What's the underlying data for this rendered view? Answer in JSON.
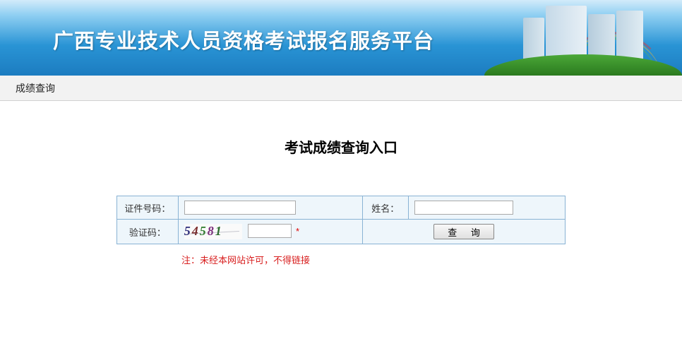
{
  "banner": {
    "title": "广西专业技术人员资格考试报名服务平台"
  },
  "nav": {
    "score_query": "成绩查询"
  },
  "page": {
    "title": "考试成绩查询入口"
  },
  "form": {
    "id_label": "证件号码：",
    "name_label": "姓名：",
    "captcha_label": "验证码：",
    "captcha_value": "54581",
    "required_mark": "*",
    "submit_label": "查 询"
  },
  "footnote": "注：未经本网站许可，不得链接"
}
